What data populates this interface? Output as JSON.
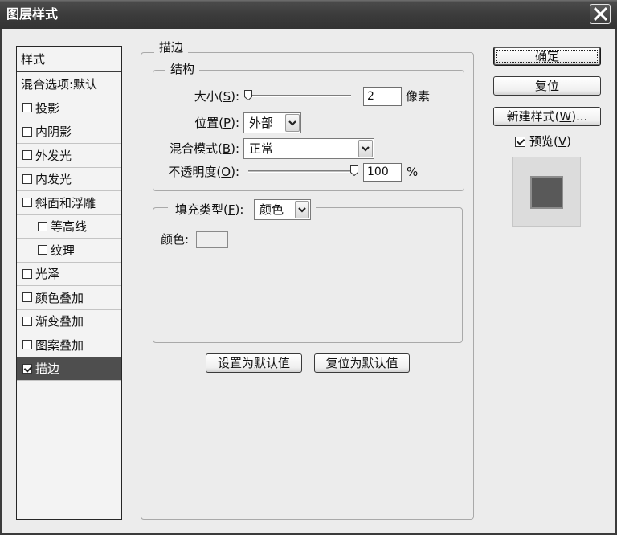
{
  "window": {
    "title": "图层样式"
  },
  "icons": {
    "close": "close-icon",
    "dropdown": "chevron-down-icon",
    "slider_thumb": "slider-thumb-icon",
    "check": "checkmark-icon"
  },
  "styles_panel": {
    "header": "样式",
    "blending_options": "混合选项:默认",
    "effects": [
      {
        "label": "投影",
        "checked": false
      },
      {
        "label": "内阴影",
        "checked": false
      },
      {
        "label": "外发光",
        "checked": false
      },
      {
        "label": "内发光",
        "checked": false
      },
      {
        "label": "斜面和浮雕",
        "checked": false,
        "children": [
          {
            "label": "等高线",
            "checked": false
          },
          {
            "label": "纹理",
            "checked": false
          }
        ]
      },
      {
        "label": "光泽",
        "checked": false
      },
      {
        "label": "颜色叠加",
        "checked": false
      },
      {
        "label": "渐变叠加",
        "checked": false
      },
      {
        "label": "图案叠加",
        "checked": false
      },
      {
        "label": "描边",
        "checked": true,
        "selected": true
      }
    ]
  },
  "stroke": {
    "title": "描边",
    "structure": {
      "title": "结构",
      "size": {
        "label": {
          "pre": "大小(",
          "key": "S",
          "post": "):"
        },
        "value": "2",
        "unit": "像素",
        "slider_fraction": 0.01
      },
      "position": {
        "label": {
          "pre": "位置(",
          "key": "P",
          "post": "):"
        },
        "value": "外部"
      },
      "blend_mode": {
        "label": {
          "pre": "混合模式(",
          "key": "B",
          "post": "):"
        },
        "value": "正常"
      },
      "opacity": {
        "label": {
          "pre": "不透明度(",
          "key": "O",
          "post": "):"
        },
        "value": "100",
        "unit": "%",
        "slider_fraction": 1.0
      }
    },
    "fill": {
      "type_label": {
        "pre": "填充类型(",
        "key": "F",
        "post": "):"
      },
      "type_value": "颜色",
      "color_label": "颜色:",
      "color": "#eeeeee"
    },
    "buttons": {
      "make_default": "设置为默认值",
      "reset_to_default": "复位为默认值"
    }
  },
  "actions": {
    "ok": "确定",
    "reset": "复位",
    "new_style": {
      "pre": "新建样式(",
      "key": "W",
      "post": ")..."
    },
    "preview": {
      "pre": "预览(",
      "key": "V",
      "post": ")",
      "checked": true
    }
  },
  "preview_swatch": {
    "background": "#dcdcdc",
    "fill": "#595959",
    "stroke": "#8c8c8c"
  }
}
